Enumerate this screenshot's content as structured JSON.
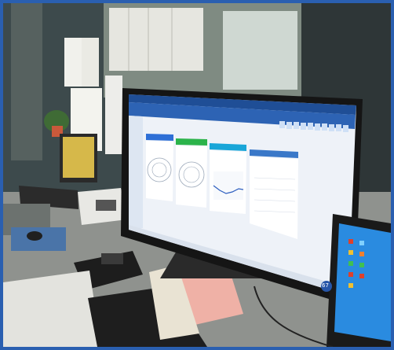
{
  "photo": {
    "description_hidden": "",
    "scene_type": "office-desk-with-monitors"
  },
  "main_monitor": {
    "app_title": "",
    "header_menu": [
      "",
      "",
      "",
      ""
    ],
    "header_right": [
      "",
      "",
      ""
    ],
    "tab_label": "",
    "page_heading": "",
    "panel_titles": [
      "",
      "",
      "",
      ""
    ],
    "panel_colors": [
      "#2e6fd6",
      "#2bb34a",
      "#19a6d8",
      "#3a78c8"
    ],
    "badge_text": "67",
    "toolbar_icons": [
      "icon-1",
      "icon-2",
      "icon-3",
      "icon-4",
      "icon-5",
      "icon-6",
      "icon-7",
      "icon-8",
      "icon-9",
      "icon-10",
      "icon-11",
      "icon-12"
    ]
  },
  "left_monitor": {
    "state": "on-yellow-screen"
  },
  "right_monitor": {
    "state": "windows-desktop",
    "accent": "#2a8be0"
  },
  "colors": {
    "frame": "#2a5fb0",
    "app_header": "#1f4e96",
    "app_body": "#e6edf6",
    "desktop_blue": "#2a8be0"
  }
}
